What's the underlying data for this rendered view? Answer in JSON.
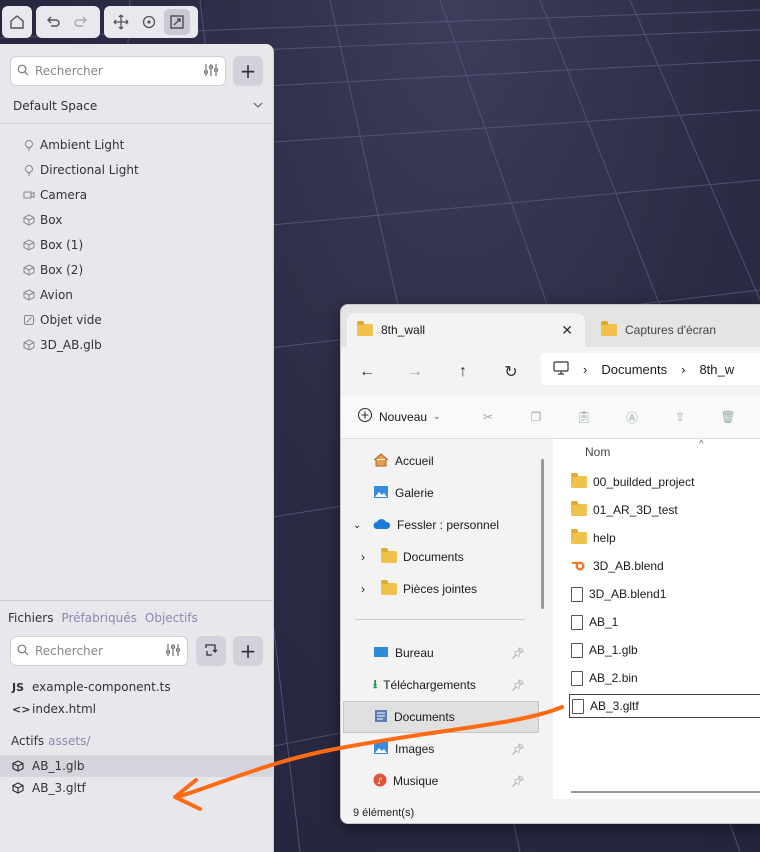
{
  "toolbar": {
    "home_icon": "home-icon",
    "undo_icon": "undo-icon",
    "redo_icon": "redo-icon",
    "move_icon": "move-icon",
    "rotate_icon": "rotate-icon",
    "scale_icon": "scale-icon"
  },
  "scene": {
    "search_placeholder": "Rechercher",
    "add_label": "+",
    "space_name": "Default Space",
    "items": [
      {
        "label": "Ambient Light",
        "icon": "bulb-icon"
      },
      {
        "label": "Directional Light",
        "icon": "bulb-icon"
      },
      {
        "label": "Camera",
        "icon": "camera-icon"
      },
      {
        "label": "Box",
        "icon": "cube-icon"
      },
      {
        "label": "Box (1)",
        "icon": "cube-icon"
      },
      {
        "label": "Box (2)",
        "icon": "cube-icon"
      },
      {
        "label": "Avion",
        "icon": "cube-icon"
      },
      {
        "label": "Objet vide",
        "icon": "empty-object-icon"
      },
      {
        "label": "3D_AB.glb",
        "icon": "cube-icon"
      }
    ]
  },
  "files_panel": {
    "tabs": [
      "Fichiers",
      "Préfabriqués",
      "Objectifs"
    ],
    "search_placeholder": "Rechercher",
    "add_label": "+",
    "files": [
      {
        "badge": "JS",
        "name": "example-component.ts"
      },
      {
        "badge": "<>",
        "name": "index.html"
      }
    ],
    "assets_label": "Actifs",
    "assets_path": "assets/",
    "assets": [
      {
        "name": "AB_1.glb",
        "selected": true
      },
      {
        "name": "AB_3.gltf",
        "selected": false
      }
    ]
  },
  "explorer": {
    "tab1_title": "8th_wall",
    "tab2_title": "Captures d'écran",
    "breadcrumb": [
      "Documents",
      "8th_w"
    ],
    "new_label": "Nouveau",
    "column_name": "Nom",
    "nav_items": [
      {
        "label": "Accueil",
        "icon": "home-icon"
      },
      {
        "label": "Galerie",
        "icon": "gallery-icon"
      },
      {
        "label": "Fessler : personnel",
        "icon": "cloud-icon"
      },
      {
        "label": "Documents",
        "icon": "folder-icon"
      },
      {
        "label": "Pièces jointes",
        "icon": "folder-icon"
      },
      {
        "label": "Bureau",
        "icon": "desktop-icon"
      },
      {
        "label": "Téléchargements",
        "icon": "download-icon"
      },
      {
        "label": "Documents",
        "icon": "documents-icon"
      },
      {
        "label": "Images",
        "icon": "images-icon"
      },
      {
        "label": "Musique",
        "icon": "music-icon"
      }
    ],
    "files": [
      {
        "name": "00_builded_project",
        "type": "folder"
      },
      {
        "name": "01_AR_3D_test",
        "type": "folder"
      },
      {
        "name": "help",
        "type": "folder"
      },
      {
        "name": "3D_AB.blend",
        "type": "blend"
      },
      {
        "name": "3D_AB.blend1",
        "type": "file"
      },
      {
        "name": "AB_1",
        "type": "file"
      },
      {
        "name": "AB_1.glb",
        "type": "file"
      },
      {
        "name": "AB_2.bin",
        "type": "file"
      },
      {
        "name": "AB_3.gltf",
        "type": "file",
        "selected": true
      }
    ],
    "status": "9 élément(s)"
  },
  "colors": {
    "drag_arrow": "#ff6a13",
    "viewport_bg": "#26263d",
    "panel_bg": "#e7e7ec",
    "accent_link": "#8a8ab0"
  }
}
